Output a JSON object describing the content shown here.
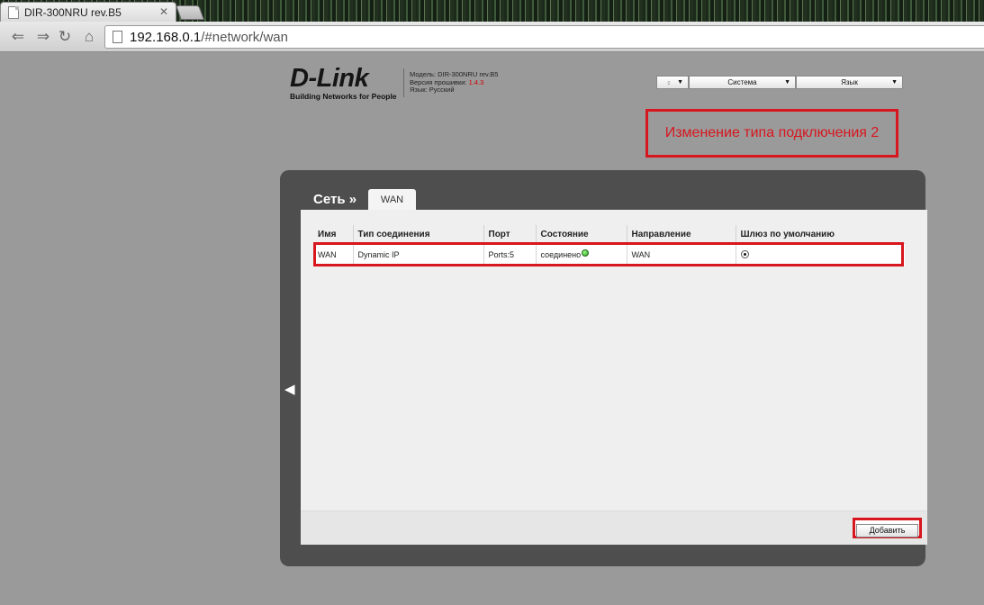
{
  "browser": {
    "tab_title": "DIR-300NRU rev.B5",
    "url_host": "192.168.0.1",
    "url_path": "/#network/wan"
  },
  "header": {
    "logo": "D-Link",
    "logo_tagline": "Building Networks for People",
    "model_line": "Модель: DIR-300NRU rev.B5",
    "firmware_label": "Версия прошивки:",
    "firmware_version": "1.4.3",
    "language_line": "Язык: Русский",
    "system_menu": "Система",
    "language_menu": "Язык"
  },
  "annotation": {
    "text": "Изменение типа подключения 2",
    "color": "#d8161e"
  },
  "panel": {
    "breadcrumb": "Сеть »",
    "tab": "WAN"
  },
  "table": {
    "headers": [
      "Имя",
      "Тип соединения",
      "Порт",
      "Состояние",
      "Направление",
      "Шлюз по умолчанию"
    ],
    "rows": [
      {
        "name": "WAN",
        "type": "Dynamic IP",
        "port": "Ports:5",
        "state": "соединено",
        "direction": "WAN",
        "default_gateway": true
      }
    ]
  },
  "actions": {
    "add_label": "Добавить"
  }
}
